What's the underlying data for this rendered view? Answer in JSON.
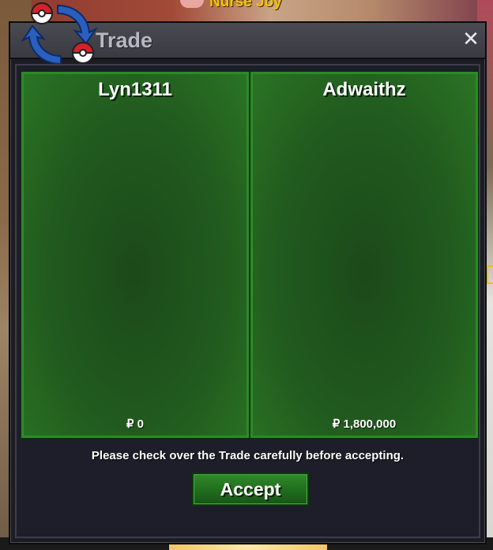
{
  "game": {
    "npc_name": "Nurse Joy"
  },
  "window": {
    "title": "Trade",
    "close_glyph": "✕",
    "logo_icon": "pokeball-trade-icon"
  },
  "trade": {
    "left": {
      "player": "Lyn1311",
      "money": "₽ 0"
    },
    "right": {
      "player": "Adwaithz",
      "money": "₽ 1,800,000"
    }
  },
  "notice": "Please check over the Trade carefully before accepting.",
  "accept_label": "Accept",
  "colors": {
    "panel_green": "#215a1e",
    "panel_border": "#2c8a28",
    "window_bg": "#1c1c22",
    "npc_name": "#f5c400"
  }
}
